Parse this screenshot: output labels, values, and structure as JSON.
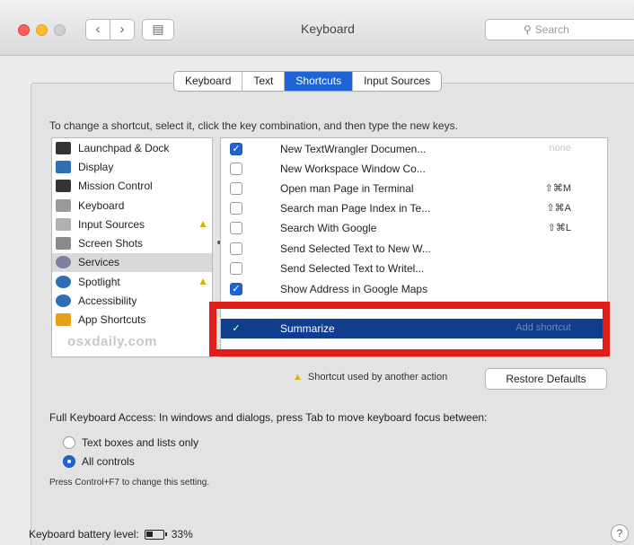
{
  "window": {
    "title": "Keyboard",
    "search_placeholder": "Search"
  },
  "tabs": [
    "Keyboard",
    "Text",
    "Shortcuts",
    "Input Sources"
  ],
  "active_tab": "Shortcuts",
  "instruction": "To change a shortcut, select it, click the key combination, and then type the new keys.",
  "categories": [
    {
      "label": "Launchpad & Dock",
      "icon": "launchpad-icon",
      "color": "#333333"
    },
    {
      "label": "Display",
      "icon": "display-icon",
      "color": "#2f6db5"
    },
    {
      "label": "Mission Control",
      "icon": "mission-control-icon",
      "color": "#333333"
    },
    {
      "label": "Keyboard",
      "icon": "keyboard-icon",
      "color": "#9a9a9a"
    },
    {
      "label": "Input Sources",
      "icon": "input-sources-icon",
      "color": "#b0b0b0",
      "warning": true
    },
    {
      "label": "Screen Shots",
      "icon": "screenshot-icon",
      "color": "#8a8a8a"
    },
    {
      "label": "Services",
      "icon": "gear-icon",
      "color": "#7f7f9f",
      "selected": true
    },
    {
      "label": "Spotlight",
      "icon": "spotlight-icon",
      "color": "#2f6db5",
      "warning": true
    },
    {
      "label": "Accessibility",
      "icon": "accessibility-icon",
      "color": "#2f6db5"
    },
    {
      "label": "App Shortcuts",
      "icon": "app-shortcuts-icon",
      "color": "#e3a21a"
    }
  ],
  "watermark": "osxdaily.com",
  "services": [
    {
      "name": "New TextWrangler Documen...",
      "checked": true,
      "shortcut": "none"
    },
    {
      "name": "New Workspace Window Co...",
      "checked": false,
      "shortcut": ""
    },
    {
      "name": "Open man Page in Terminal",
      "checked": false,
      "shortcut": "⇧⌘M"
    },
    {
      "name": "Search man Page Index in Te...",
      "checked": false,
      "shortcut": "⇧⌘A"
    },
    {
      "name": "Search With Google",
      "checked": false,
      "shortcut": "⇧⌘L"
    },
    {
      "name": "Send Selected Text to New W...",
      "checked": false,
      "shortcut": ""
    },
    {
      "name": "Send Selected Text to Writel...",
      "checked": false,
      "shortcut": ""
    },
    {
      "name": "Show Address in Google Maps",
      "checked": true,
      "shortcut": ""
    },
    {
      "name": "Summarize",
      "checked": true,
      "shortcut": "Add shortcut",
      "selected": true
    }
  ],
  "shortcut_conflict_note": "Shortcut used by another action",
  "restore_defaults": "Restore Defaults",
  "full_keyboard_access": "Full Keyboard Access: In windows and dialogs, press Tab to move keyboard focus between:",
  "radio_options": [
    {
      "label": "Text boxes and lists only",
      "selected": false
    },
    {
      "label": "All controls",
      "selected": true
    }
  ],
  "hint": "Press Control+F7 to change this setting.",
  "battery": {
    "label": "Keyboard battery level:",
    "value": "33%"
  },
  "help": "?"
}
